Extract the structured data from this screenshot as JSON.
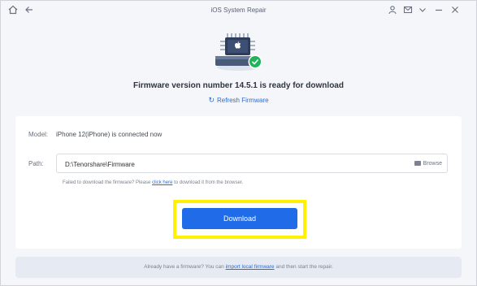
{
  "window": {
    "title": "iOS System Repair",
    "icons": [
      "home-icon",
      "back-icon",
      "user-icon",
      "mail-icon",
      "chevron-down-icon",
      "minimize-icon",
      "close-icon"
    ]
  },
  "hero": {
    "status_text": "Firmware version number 14.5.1 is ready for download",
    "refresh_label": "Refresh Firmware"
  },
  "device": {
    "model_label": "Model:",
    "model_value": "iPhone 12(iPhone) is connected now"
  },
  "path": {
    "label": "Path:",
    "value": "D:\\Tenorshare\\Firmware",
    "browse_label": "Browse"
  },
  "fail_note": {
    "before": "Failed to download the firmware? Please ",
    "link": "click here",
    "after": " to download it from the browser."
  },
  "actions": {
    "download_label": "Download"
  },
  "footer": {
    "before": "Already have a firmware? You can ",
    "link": "import local firmware",
    "after": " and then start the repair."
  },
  "colors": {
    "accent": "#1f6be8",
    "highlight": "#fff200",
    "success": "#1fb35a"
  }
}
